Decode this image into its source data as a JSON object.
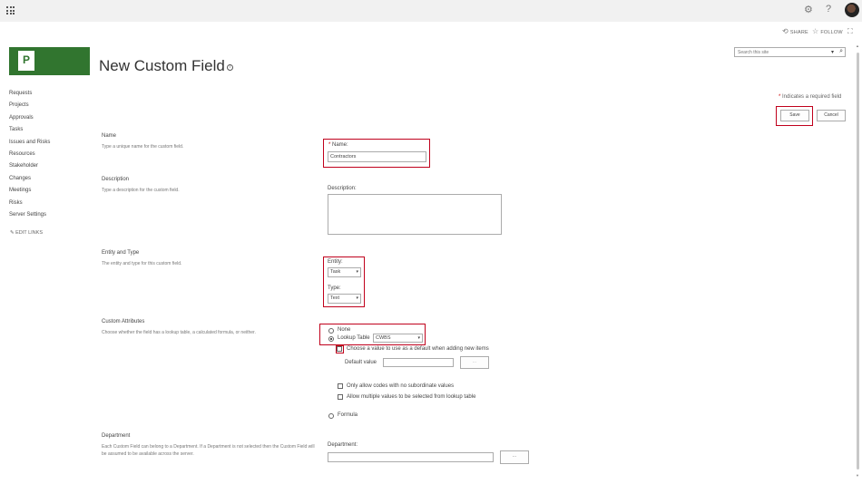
{
  "suite": {
    "share_label": "SHARE",
    "follow_label": "FOLLOW",
    "help_glyph": "?"
  },
  "page": {
    "title": "New Custom Field",
    "info_glyph": "i"
  },
  "search": {
    "placeholder": "Search this site"
  },
  "nav": {
    "items": [
      "Requests",
      "Projects",
      "Approvals",
      "Tasks",
      "Issues and Risks",
      "Resources",
      "Stakeholder",
      "Changes",
      "Meetings",
      "Risks",
      "Server Settings"
    ],
    "edit_links": "EDIT LINKS"
  },
  "required_note": {
    "star": "*",
    "text": "Indicates a required field"
  },
  "buttons": {
    "save": "Save",
    "cancel": "Cancel"
  },
  "sections": {
    "name": {
      "title": "Name",
      "desc": "Type a unique name for the custom field.",
      "label": "Name:",
      "star": "*",
      "value": "Contractors"
    },
    "description": {
      "title": "Description",
      "desc": "Type a description for the custom field.",
      "label": "Description:",
      "value": ""
    },
    "entity_type": {
      "title": "Entity and Type",
      "desc": "The entity and type for this custom field.",
      "entity_label": "Entity:",
      "entity_value": "Task",
      "type_label": "Type:",
      "type_value": "Text"
    },
    "custom_attributes": {
      "title": "Custom Attributes",
      "desc": "Choose whether the field has a lookup table, a calculated formula, or neither.",
      "none_label": "None",
      "lookup_label": "Lookup Table",
      "lookup_value": "CWBS",
      "choose_default_label": "Choose a value to use as a default when adding new items",
      "default_value_label": "Default value",
      "default_value": "",
      "browse_label": "...",
      "only_codes_label": "Only allow codes with no subordinate values",
      "multiple_values_label": "Allow multiple values to be selected from lookup table",
      "formula_label": "Formula",
      "selected": "lookup"
    },
    "department": {
      "title": "Department",
      "desc": "Each Custom Field can belong to a Department. If a Department is not selected then the Custom Field will be assumed to be available across the server.",
      "label": "Department:",
      "value": "",
      "browse_label": "..."
    }
  },
  "colors": {
    "brand": "#31752f",
    "highlight": "#c0001c"
  },
  "icons": [
    "app-launcher-icon",
    "gear-icon",
    "help-icon",
    "share-icon",
    "star-icon",
    "focus-icon",
    "info-icon",
    "search-icon",
    "pencil-icon"
  ]
}
